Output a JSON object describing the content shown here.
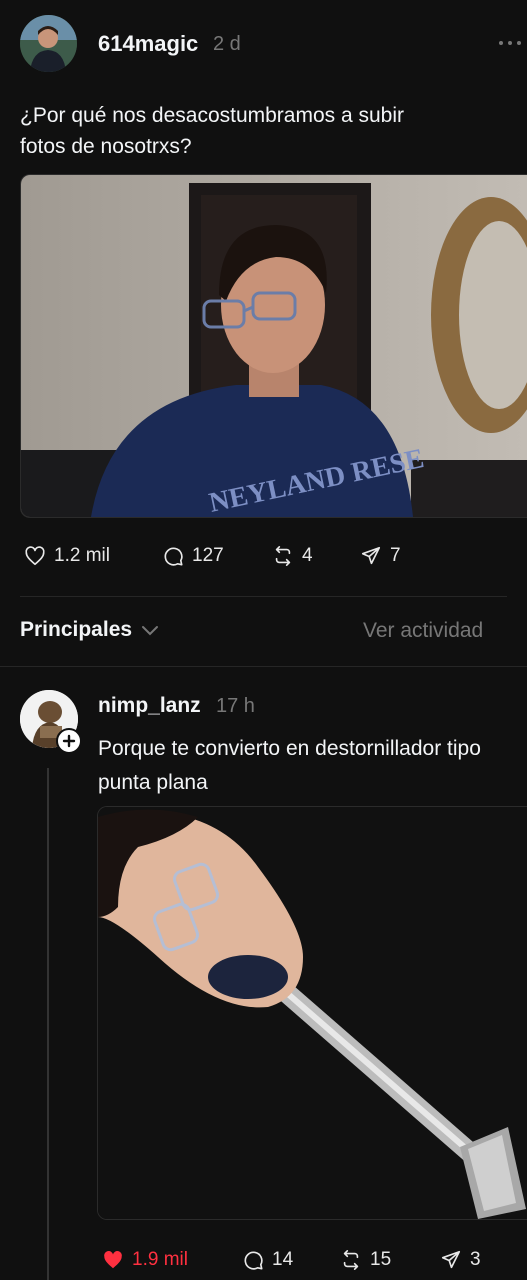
{
  "post": {
    "username": "614magic",
    "time": "2 d",
    "text_line1": "¿Por qué nos desacostumbramos a subir",
    "text_line2": "fotos de nosotrxs?",
    "sweater_text": "NEYLAND RESE",
    "stats": {
      "likes": "1.2 mil",
      "comments": "127",
      "reposts": "4",
      "shares": "7"
    }
  },
  "section": {
    "title": "Principales",
    "activity_link": "Ver actividad"
  },
  "reply": {
    "username": "nimp_lanz",
    "time": "17 h",
    "text_line1": "Porque te convierto en destornillador tipo",
    "text_line2": "punta plana",
    "stats": {
      "likes": "1.9 mil",
      "comments": "14",
      "reposts": "15",
      "shares": "3"
    }
  },
  "colors": {
    "background": "#101010",
    "liked": "#ff3040",
    "muted": "#777777"
  },
  "icons": [
    "more-icon",
    "heart-icon",
    "comment-icon",
    "repost-icon",
    "share-icon",
    "chevron-down-icon",
    "follow-plus-icon"
  ]
}
